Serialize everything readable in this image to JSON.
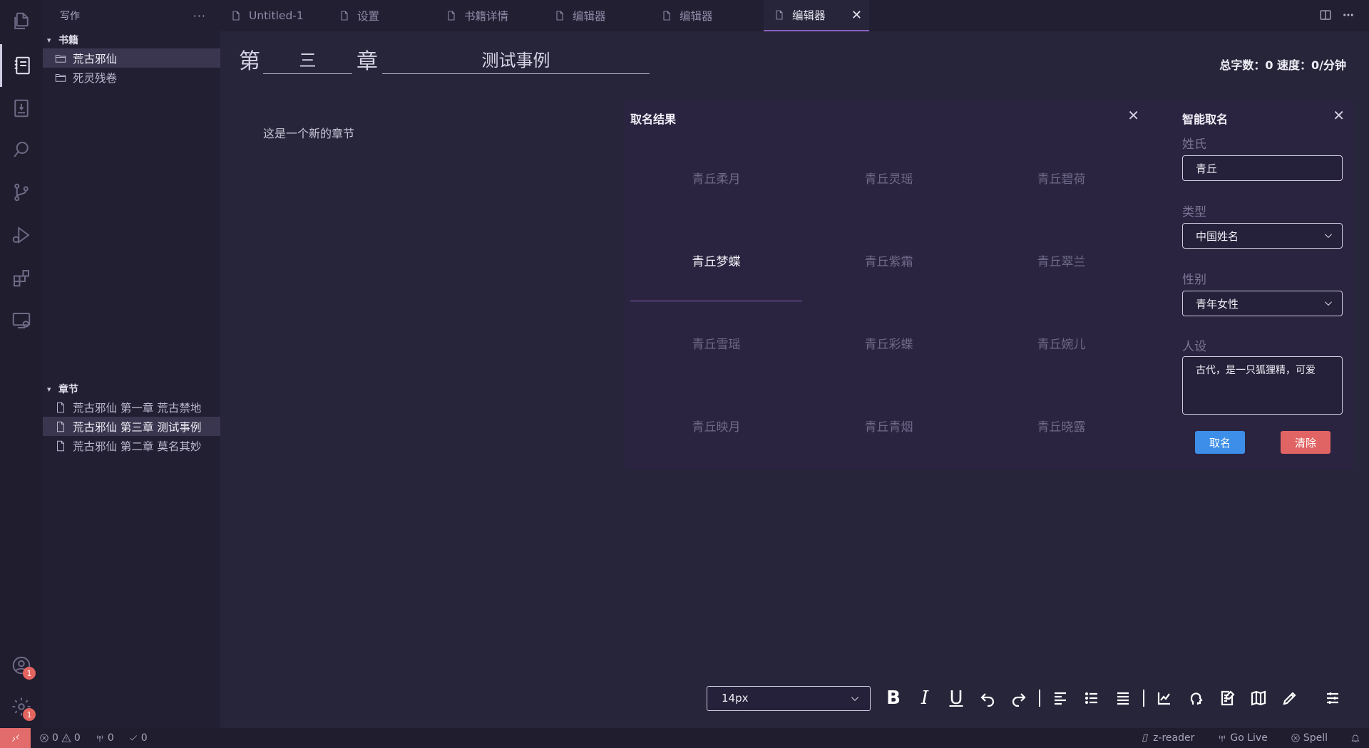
{
  "sidebar": {
    "title": "写作",
    "more": "···",
    "books_section": "书籍",
    "books": [
      "荒古邪仙",
      "死灵残卷"
    ],
    "chapters_section": "章节",
    "chapters": [
      "荒古邪仙 第一章 荒古禁地",
      "荒古邪仙 第三章 测试事例",
      "荒古邪仙 第二章 莫名其妙"
    ]
  },
  "tabs": [
    {
      "label": "Untitled-1"
    },
    {
      "label": "设置"
    },
    {
      "label": "书籍详情"
    },
    {
      "label": "编辑器"
    },
    {
      "label": "编辑器"
    },
    {
      "label": "编辑器",
      "active": true,
      "close": "✕"
    }
  ],
  "editor": {
    "chapter_prefix": "第",
    "chapter_number": "三",
    "chapter_suffix": "章",
    "chapter_name": "测试事例",
    "word_count": "总字数：0 速度：0/分钟",
    "content": "这是一个新的章节"
  },
  "results": {
    "title": "取名结果",
    "close": "✕",
    "names": [
      "青丘柔月",
      "青丘灵瑶",
      "青丘碧荷",
      "青丘梦蝶",
      "青丘紫霜",
      "青丘翠兰",
      "青丘雪瑶",
      "青丘彩蝶",
      "青丘婉儿",
      "青丘映月",
      "青丘青烟",
      "青丘晓露"
    ],
    "active_index": 3
  },
  "smart": {
    "title": "智能取名",
    "close": "✕",
    "surname_label": "姓氏",
    "surname_value": "青丘",
    "type_label": "类型",
    "type_value": "中国姓名",
    "gender_label": "性别",
    "gender_value": "青年女性",
    "persona_label": "人设",
    "persona_value": "古代，是一只狐狸精，可爱",
    "name_button": "取名",
    "clear_button": "清除"
  },
  "toolbar": {
    "font_size": "14px",
    "bold": "B",
    "italic": "I",
    "underline": "U"
  },
  "activity": {
    "badge_account": "1",
    "badge_settings": "1"
  },
  "status": {
    "errors": "0",
    "warnings": "0",
    "ports": "0",
    "checks": "0",
    "zreader": "z-reader",
    "golive": "Go Live",
    "spell": "Spell"
  },
  "colors": {
    "accent": "#8b5fbf",
    "primary_button": "#3d8ee8",
    "danger_button": "#e16464",
    "remote_indicator": "#e26b6b"
  }
}
